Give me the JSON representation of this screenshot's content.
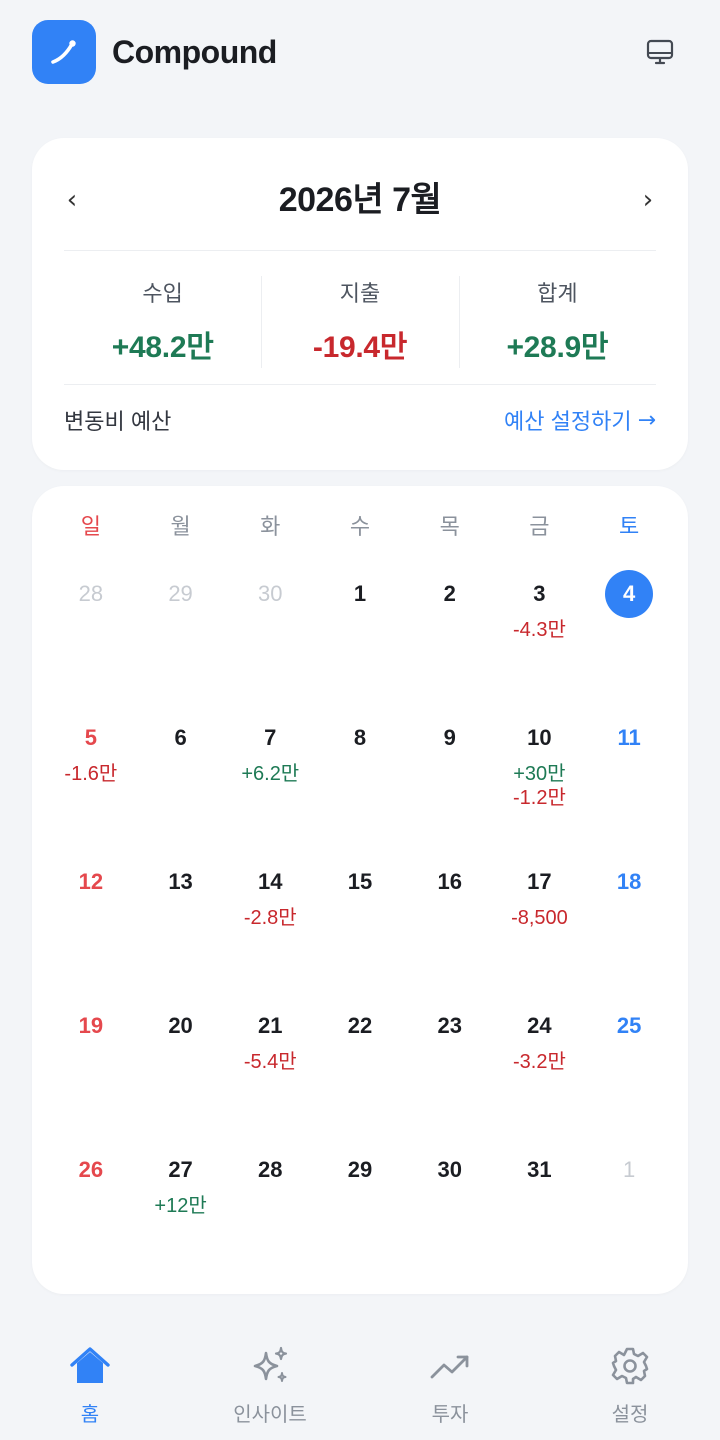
{
  "app": {
    "title": "Compound"
  },
  "colors": {
    "accent": "#3182F6",
    "income": "#1E7A55",
    "expense": "#C8282D",
    "sunday": "#E5484D",
    "saturday": "#3182F6"
  },
  "summary": {
    "month": "2026년 7월",
    "prev": "‹",
    "next": "›",
    "income_label": "수입",
    "income_value": "+48.2만",
    "expense_label": "지출",
    "expense_value": "-19.4만",
    "total_label": "합계",
    "total_value": "+28.9만",
    "budget_label": "변동비 예산",
    "budget_link": "예산 설정하기",
    "budget_link_arrow": "→"
  },
  "calendar": {
    "weekdays": [
      "일",
      "월",
      "화",
      "수",
      "목",
      "금",
      "토"
    ],
    "days": [
      {
        "d": "28",
        "muted": true
      },
      {
        "d": "29",
        "muted": true
      },
      {
        "d": "30",
        "muted": true
      },
      {
        "d": "1"
      },
      {
        "d": "2"
      },
      {
        "d": "3",
        "amounts": [
          {
            "t": "-4.3만",
            "k": "expense"
          }
        ]
      },
      {
        "d": "4",
        "today": true
      },
      {
        "d": "5",
        "amounts": [
          {
            "t": "-1.6만",
            "k": "expense"
          }
        ]
      },
      {
        "d": "6"
      },
      {
        "d": "7",
        "amounts": [
          {
            "t": "+6.2만",
            "k": "income"
          }
        ]
      },
      {
        "d": "8"
      },
      {
        "d": "9"
      },
      {
        "d": "10",
        "amounts": [
          {
            "t": "+30만",
            "k": "income"
          },
          {
            "t": "-1.2만",
            "k": "expense"
          }
        ]
      },
      {
        "d": "11"
      },
      {
        "d": "12"
      },
      {
        "d": "13"
      },
      {
        "d": "14",
        "amounts": [
          {
            "t": "-2.8만",
            "k": "expense"
          }
        ]
      },
      {
        "d": "15"
      },
      {
        "d": "16"
      },
      {
        "d": "17",
        "amounts": [
          {
            "t": "-8,500",
            "k": "expense"
          }
        ]
      },
      {
        "d": "18"
      },
      {
        "d": "19"
      },
      {
        "d": "20"
      },
      {
        "d": "21",
        "amounts": [
          {
            "t": "-5.4만",
            "k": "expense"
          }
        ]
      },
      {
        "d": "22"
      },
      {
        "d": "23"
      },
      {
        "d": "24",
        "amounts": [
          {
            "t": "-3.2만",
            "k": "expense"
          }
        ]
      },
      {
        "d": "25"
      },
      {
        "d": "26"
      },
      {
        "d": "27",
        "amounts": [
          {
            "t": "+12만",
            "k": "income"
          }
        ]
      },
      {
        "d": "28"
      },
      {
        "d": "29"
      },
      {
        "d": "30"
      },
      {
        "d": "31"
      },
      {
        "d": "1",
        "muted": true
      }
    ]
  },
  "nav": {
    "items": [
      {
        "label": "홈",
        "icon": "home-icon",
        "active": true
      },
      {
        "label": "인사이트",
        "icon": "sparkles-icon"
      },
      {
        "label": "투자",
        "icon": "trending-up-icon"
      },
      {
        "label": "설정",
        "icon": "gear-icon"
      }
    ]
  }
}
